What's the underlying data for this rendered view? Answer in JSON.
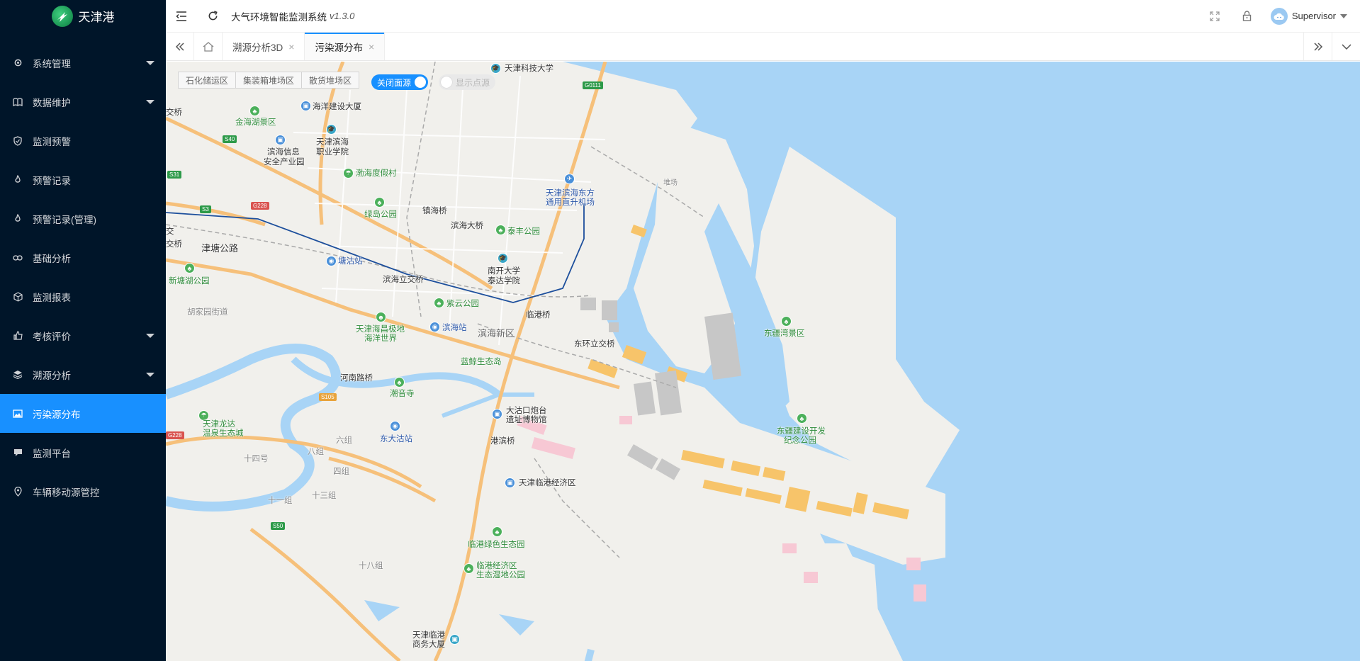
{
  "sidebar": {
    "brand": "天津港",
    "items": [
      {
        "label": "系统管理",
        "icon": "gear-icon",
        "has_submenu": true
      },
      {
        "label": "数据维护",
        "icon": "book-icon",
        "has_submenu": true
      },
      {
        "label": "监测预警",
        "icon": "shield-icon",
        "has_submenu": false
      },
      {
        "label": "预警记录",
        "icon": "flame-icon",
        "has_submenu": false
      },
      {
        "label": "预警记录(管理)",
        "icon": "flame-icon",
        "has_submenu": false
      },
      {
        "label": "基础分析",
        "icon": "infinity-icon",
        "has_submenu": false
      },
      {
        "label": "监测报表",
        "icon": "cube-icon",
        "has_submenu": false
      },
      {
        "label": "考核评价",
        "icon": "thumb-icon",
        "has_submenu": true
      },
      {
        "label": "溯源分析",
        "icon": "layers-icon",
        "has_submenu": true
      },
      {
        "label": "污染源分布",
        "icon": "image-icon",
        "has_submenu": false,
        "active": true
      },
      {
        "label": "监测平台",
        "icon": "chat-icon",
        "has_submenu": false
      },
      {
        "label": "车辆移动源管控",
        "icon": "location-pin-icon",
        "has_submenu": false
      }
    ]
  },
  "header": {
    "title": "大气环境智能监测系统",
    "version": "v1.3.0",
    "user": "Supervisor"
  },
  "tabs": {
    "items": [
      {
        "label": "溯源分析3D",
        "active": false
      },
      {
        "label": "污染源分布",
        "active": true
      }
    ]
  },
  "map": {
    "zone_buttons": [
      "石化储运区",
      "集装箱堆场区",
      "散货堆场区"
    ],
    "toggle_close": {
      "label": "关闭面源",
      "on": true
    },
    "toggle_points": {
      "label": "显示点源",
      "on": false
    },
    "labels": {
      "tjkj": "天津科技大学",
      "g0111": "G0111",
      "hyjs": "海洋建设大厦",
      "jhh": "金海湖景区",
      "jiaoqiao": "交桥",
      "s40": "S40",
      "bhxx1": "滨海信息",
      "bhxx2": "安全产业园",
      "tjbh1": "天津滨海",
      "tjbh2": "职业学院",
      "s31": "S31",
      "bhdjc": "渤海度假村",
      "g228": "G228",
      "s3": "S3",
      "ld": "绿岛公园",
      "zhq": "镇海桥",
      "bhdq": "滨海大桥",
      "tf": "泰丰公园",
      "tjdf1": "天津滨海东方",
      "tjdf2": "通用直升机场",
      "duichang": "堆场",
      "jiao2a": "交",
      "jiao2b": "交桥",
      "jtgl": "津塘公路",
      "tgz": "塘沽站",
      "nk1": "南开大学",
      "nk2": "泰达学院",
      "xtgy": "新塘湖公园",
      "bhlj": "滨海立交桥",
      "hjyj": "胡家园街道",
      "zy": "紫云公园",
      "lgq": "临港桥",
      "hc1": "天津海昌极地",
      "hc2": "海洋世界",
      "bhz": "滨海站",
      "bhxq": "滨海新区",
      "dgljq": "东环立交桥",
      "dj": "东疆湾景区",
      "ljsty": "蓝鲸生态岛",
      "hnlq": "河南路桥",
      "cyq": "潮音寺",
      "s105": "S105",
      "dgk1": "大沽口炮台",
      "dgk2": "遗址博物馆",
      "ld1": "天津龙达",
      "ld2": "温泉生态城",
      "g228b": "G228",
      "dgz": "东大沽站",
      "djkf1": "东疆建设开发",
      "djkf2": "纪念公园",
      "lz": "六组",
      "bz": "八组",
      "gbq": "港滨桥",
      "s14h": "十四号",
      "sz": "四组",
      "tjlg": "天津临港经济区",
      "s11z": "十一组",
      "s13z": "十三组",
      "s50": "S50",
      "lgls": "临港绿色生态园",
      "s18z": "十八组",
      "lgjj1": "临港经济区",
      "lgjj2": "生态湿地公园",
      "tjsw1": "天津临港",
      "tjsw2": "商务大厦"
    }
  }
}
